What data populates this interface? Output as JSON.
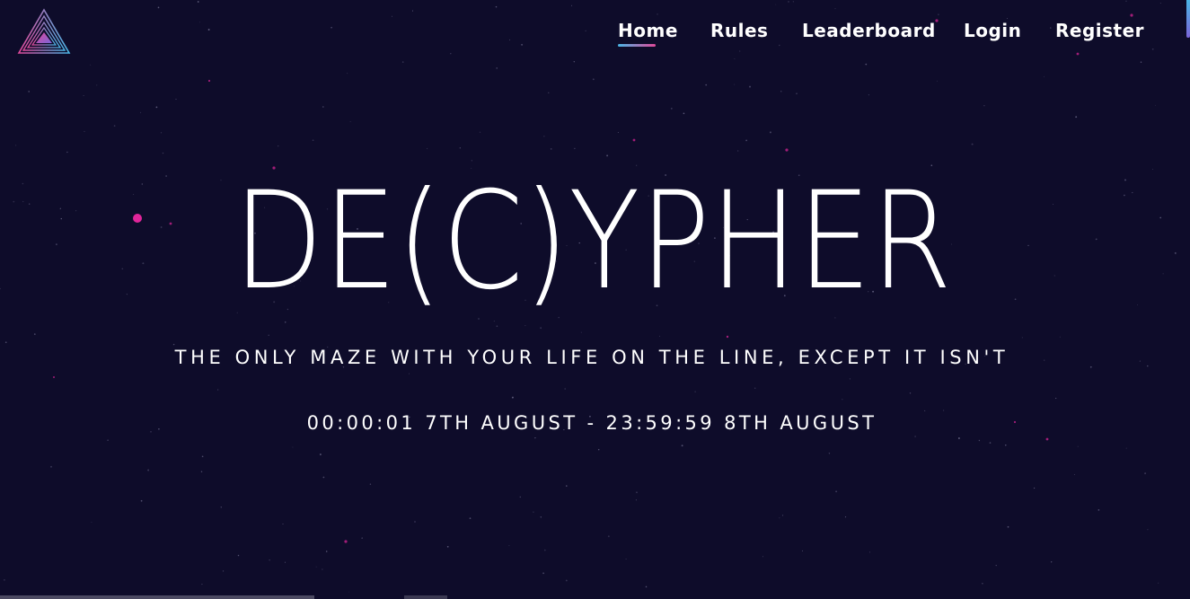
{
  "brand": {
    "logo_icon": "triangle-logo-icon",
    "colors": {
      "background": "#0e0c2a",
      "accent_pink": "#e0499a",
      "accent_blue": "#4ab6e6",
      "accent_purple": "#7a64d8"
    }
  },
  "nav": {
    "items": [
      {
        "label": "Home",
        "active": true
      },
      {
        "label": "Rules",
        "active": false
      },
      {
        "label": "Leaderboard",
        "active": false
      },
      {
        "label": "Login",
        "active": false
      },
      {
        "label": "Register",
        "active": false
      }
    ]
  },
  "hero": {
    "title": "DE(C)YPHER",
    "tagline": "THE ONLY MAZE WITH YOUR LIFE ON THE LINE, EXCEPT IT ISN'T",
    "dates": "00:00:01 7TH AUGUST - 23:59:59 8TH AUGUST"
  }
}
